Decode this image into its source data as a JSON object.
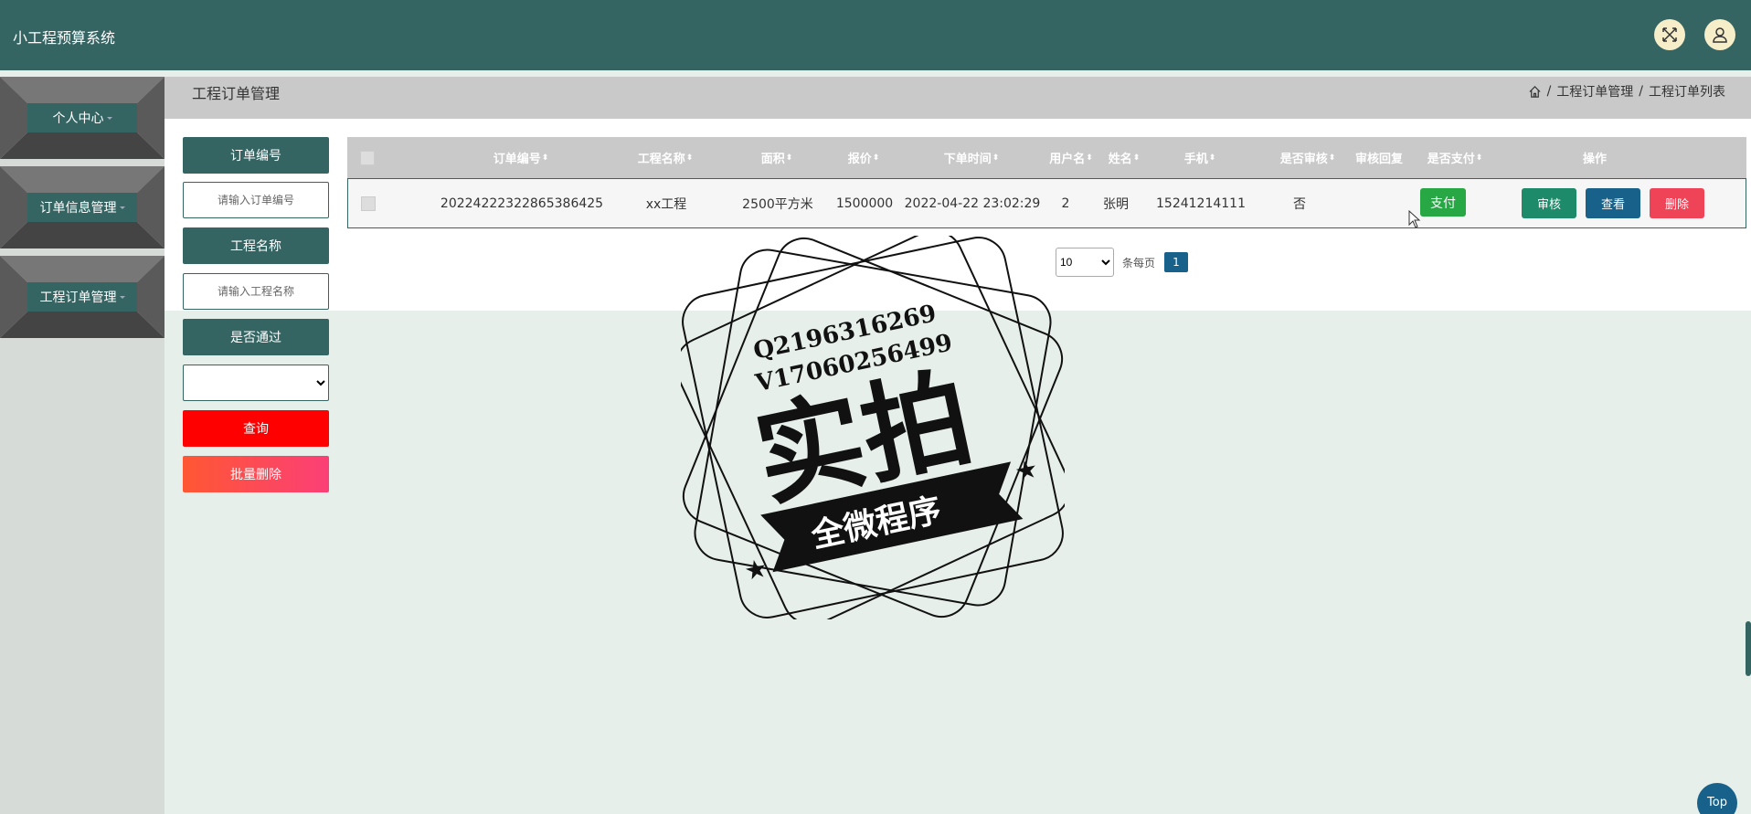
{
  "app": {
    "title": "小工程预算系统"
  },
  "header": {
    "fullscreen_icon": "fullscreen-icon",
    "user_icon": "user-icon"
  },
  "sidebar": {
    "items": [
      {
        "label": "个人中心"
      },
      {
        "label": "订单信息管理"
      },
      {
        "label": "工程订单管理"
      }
    ]
  },
  "page": {
    "title": "工程订单管理",
    "breadcrumb": [
      "工程订单管理",
      "工程订单列表"
    ],
    "breadcrumb_sep": "/"
  },
  "search": {
    "order_no_label": "订单编号",
    "order_no_placeholder": "请输入订单编号",
    "project_name_label": "工程名称",
    "project_name_placeholder": "请输入工程名称",
    "passed_label": "是否通过",
    "passed_value": "",
    "query_button": "查询",
    "batch_delete_button": "批量删除"
  },
  "table": {
    "columns": [
      "订单编号",
      "工程名称",
      "面积",
      "报价",
      "下单时间",
      "用户名",
      "姓名",
      "手机",
      "是否审核",
      "审核回复",
      "是否支付",
      "操作"
    ],
    "rows": [
      {
        "order_no": "20224222322865386425",
        "project_name": "xx工程",
        "area": "2500平方米",
        "price": "1500000",
        "order_time": "2022-04-22 23:02:29",
        "username": "2",
        "name": "张明",
        "phone": "15241214111",
        "reviewed": "否",
        "review_reply": "",
        "pay_button": "支付",
        "review_button": "审核",
        "view_button": "查看",
        "delete_button": "删除"
      }
    ]
  },
  "pagination": {
    "page_size": "10",
    "per_page_text": "条每页",
    "current_page": "1"
  },
  "watermark": {
    "line1": "Q2196316269",
    "line2": "V17060256499",
    "main": "实拍",
    "banner": "全微程序"
  },
  "top_button": "Top",
  "colors": {
    "header": "#356563",
    "sidebar_bg": "#d6dbd8",
    "query": "#ff0000",
    "pay": "#28a745",
    "review": "#1d8a6a",
    "view": "#17618a",
    "delete": "#ef4458"
  }
}
